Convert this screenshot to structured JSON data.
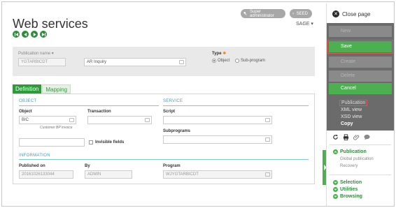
{
  "header": {
    "title": "Web services",
    "super_admin": "Super administrator",
    "seed": "SEED",
    "sage": "SAGE"
  },
  "pub": {
    "name_label": "Publication name",
    "name_value": "YGTARBICDT",
    "desc_value": "AR Inquiry",
    "type_label": "Type",
    "type_options": [
      "Object",
      "Sub-program"
    ],
    "type_selected": "Object"
  },
  "tabs": [
    "Definition",
    "Mapping"
  ],
  "object_section": {
    "title": "OBJECT",
    "object_label": "Object",
    "object_value": "BIC",
    "object_hint": "Customer BP invoice",
    "transaction_label": "Transaction",
    "invisible_label": "Invisible fields"
  },
  "service_section": {
    "title": "SERVICE",
    "script_label": "Script",
    "subprograms_label": "Subprograms"
  },
  "info_section": {
    "title": "INFORMATION",
    "published_label": "Published on",
    "published_value": "20161026133044",
    "by_label": "By",
    "by_value": "ADMIN",
    "program_label": "Program",
    "program_value": "WJYGTARBICDT"
  },
  "sidebar": {
    "close": "Close page",
    "buttons": [
      "New",
      "Save",
      "Create",
      "Delete",
      "Cancel"
    ],
    "links": [
      "Publication",
      "XML view",
      "XSD view",
      "Copy"
    ],
    "sections": [
      {
        "title": "Publication",
        "items": [
          "Global publication",
          "Recovery"
        ]
      },
      {
        "title": "Selection",
        "items": []
      },
      {
        "title": "Utilities",
        "items": []
      },
      {
        "title": "Browsing",
        "items": []
      }
    ]
  },
  "colors": {
    "accent_green": "#4caf50",
    "section_blue": "#3aa0c8",
    "sidebar_dark": "#6b6b6b"
  }
}
